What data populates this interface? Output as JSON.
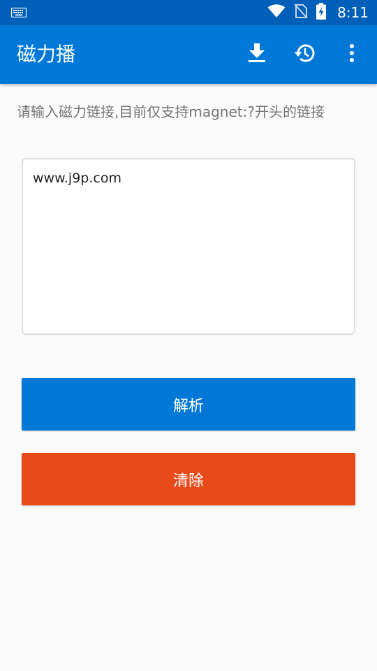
{
  "status_bar": {
    "time": "8:11",
    "icons": [
      "keyboard-icon",
      "wifi-icon",
      "no-sim-icon",
      "battery-charging-icon"
    ]
  },
  "app_bar": {
    "title": "磁力播",
    "actions": [
      "download-icon",
      "history-icon",
      "more-vert-icon"
    ]
  },
  "main": {
    "hint": "请输入磁力链接,目前仅支持magnet:?开头的链接",
    "input_value": "www.j9p.com",
    "parse_label": "解析",
    "clear_label": "清除"
  },
  "colors": {
    "status_bar": "#005fb8",
    "app_bar": "#0078d7",
    "parse_button": "#0078d7",
    "clear_button": "#e84a1a"
  }
}
